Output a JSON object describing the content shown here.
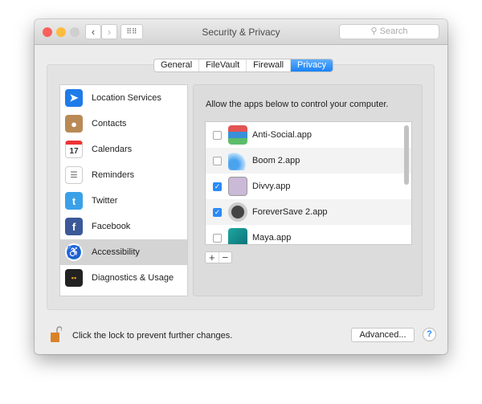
{
  "window": {
    "title": "Security & Privacy",
    "search_placeholder": "Search"
  },
  "tabs": [
    {
      "label": "General"
    },
    {
      "label": "FileVault"
    },
    {
      "label": "Firewall"
    },
    {
      "label": "Privacy",
      "selected": true
    }
  ],
  "sidebar": {
    "items": [
      {
        "label": "Location Services",
        "icon": "location-arrow-icon"
      },
      {
        "label": "Contacts",
        "icon": "contacts-book-icon"
      },
      {
        "label": "Calendars",
        "icon": "calendar-icon",
        "badge": "17"
      },
      {
        "label": "Reminders",
        "icon": "reminders-list-icon"
      },
      {
        "label": "Twitter",
        "icon": "twitter-bird-icon"
      },
      {
        "label": "Facebook",
        "icon": "facebook-f-icon"
      },
      {
        "label": "Accessibility",
        "icon": "accessibility-icon",
        "selected": true
      },
      {
        "label": "Diagnostics & Usage",
        "icon": "diagnostics-icon"
      }
    ]
  },
  "main": {
    "description": "Allow the apps below to control your computer.",
    "apps": [
      {
        "name": "Anti-Social.app",
        "checked": false
      },
      {
        "name": "Boom 2.app",
        "checked": false
      },
      {
        "name": "Divvy.app",
        "checked": true
      },
      {
        "name": "ForeverSave 2.app",
        "checked": true
      },
      {
        "name": "Maya.app",
        "checked": false
      }
    ],
    "add_label": "+",
    "remove_label": "−"
  },
  "footer": {
    "lock_text": "Click the lock to prevent further changes.",
    "advanced_label": "Advanced...",
    "help_label": "?"
  },
  "colors": {
    "accent": "#1a82f6",
    "close": "#fc605c",
    "minimize": "#fdbc40",
    "lock": "#d9822b"
  }
}
